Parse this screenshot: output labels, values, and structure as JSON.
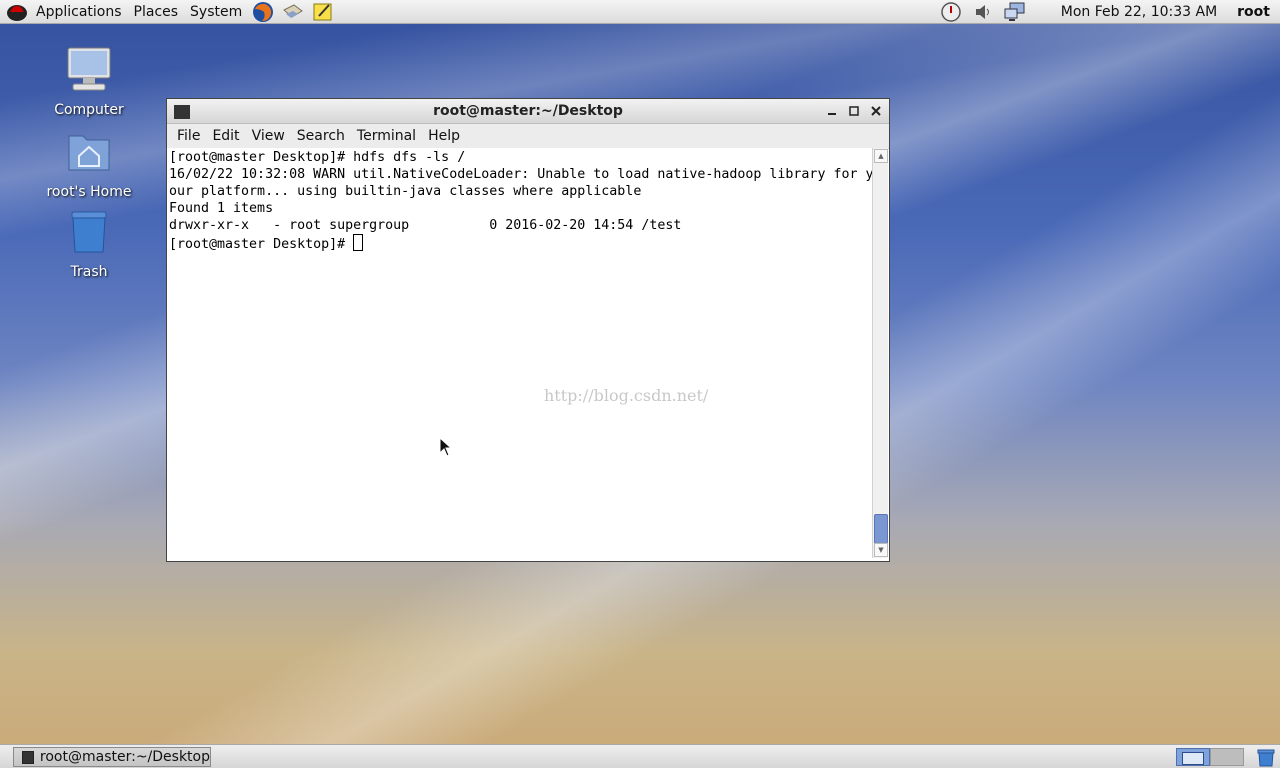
{
  "top_panel": {
    "menus": [
      "Applications",
      "Places",
      "System"
    ],
    "clock": "Mon Feb 22, 10:33 AM",
    "user": "root",
    "launchers": [
      "firefox-icon",
      "mail-icon",
      "notes-icon"
    ],
    "tray": [
      "update-icon",
      "volume-icon",
      "network-icon"
    ]
  },
  "desktop": {
    "icons": [
      {
        "label": "Computer",
        "icon": "computer-icon"
      },
      {
        "label": "root's Home",
        "icon": "home-folder-icon"
      },
      {
        "label": "Trash",
        "icon": "trash-icon"
      }
    ]
  },
  "terminal": {
    "title": "root@master:~/Desktop",
    "menu": [
      "File",
      "Edit",
      "View",
      "Search",
      "Terminal",
      "Help"
    ],
    "lines": [
      "[root@master Desktop]# hdfs dfs -ls /",
      "16/02/22 10:32:08 WARN util.NativeCodeLoader: Unable to load native-hadoop library for y",
      "our platform... using builtin-java classes where applicable",
      "Found 1 items",
      "drwxr-xr-x   - root supergroup          0 2016-02-20 14:54 /test",
      "[root@master Desktop]# "
    ],
    "watermark": "http://blog.csdn.net/"
  },
  "bottom_panel": {
    "task_label": "root@master:~/Desktop"
  },
  "colors": {
    "accent": "#7b97d2",
    "workspace_active": "#7fa2dd"
  }
}
